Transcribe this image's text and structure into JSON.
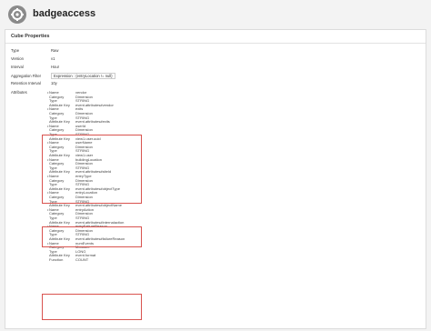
{
  "app": {
    "title": "badgeaccess",
    "logo_icon": "gear-icon"
  },
  "panel": {
    "title": "Cube Properties"
  },
  "properties": [
    {
      "key": "Type",
      "value": "Raw"
    },
    {
      "key": "Version",
      "value": "v1"
    },
    {
      "key": "Interval",
      "value": "Hour"
    },
    {
      "key": "Aggregation Filter",
      "value": "Expression",
      "expr": "{entryLocation != null}"
    },
    {
      "key": "Retention Interval",
      "value": "10y"
    }
  ],
  "attributes_label": "Attributes",
  "attributes": [
    {
      "name": "vendor",
      "category": "Dimension",
      "type": "STRING",
      "key": "event.attributes#vendor"
    },
    {
      "name": "exits",
      "category": "Dimension",
      "type": "STRING",
      "key": "event.attributes#exits"
    },
    {
      "name": "userId",
      "category": "Dimension",
      "type": "STRING",
      "key": "view1.user.uuid"
    },
    {
      "name": "userName",
      "category": "Dimension",
      "type": "STRING",
      "key": "view1.user"
    },
    {
      "name": "buildingLocation",
      "category": "Dimension",
      "type": "STRING",
      "key": "event.attributes#siteId"
    },
    {
      "name": "entryType",
      "category": "Dimension",
      "type": "STRING",
      "key": "event.attributes#objectType"
    },
    {
      "name": "entryLocation",
      "category": "Dimension",
      "type": "STRING",
      "key": "event.attributes#objectName"
    },
    {
      "name": "entryAction",
      "category": "Dimension",
      "type": "STRING",
      "key": "event.attributes#internalaction"
    },
    {
      "name": "entryFailureReason",
      "category": "Dimension",
      "type": "STRING",
      "key": "event.attributes#failureReason"
    },
    {
      "name": "numEvents",
      "category": "Measure",
      "type": "LONG",
      "key": "event.format",
      "function": "COUNT"
    }
  ],
  "row_labels": {
    "name": "Name",
    "category": "Category",
    "type": "Type",
    "key": "Attribute Key",
    "function": "Function"
  },
  "highlight_color": "#d9534f"
}
